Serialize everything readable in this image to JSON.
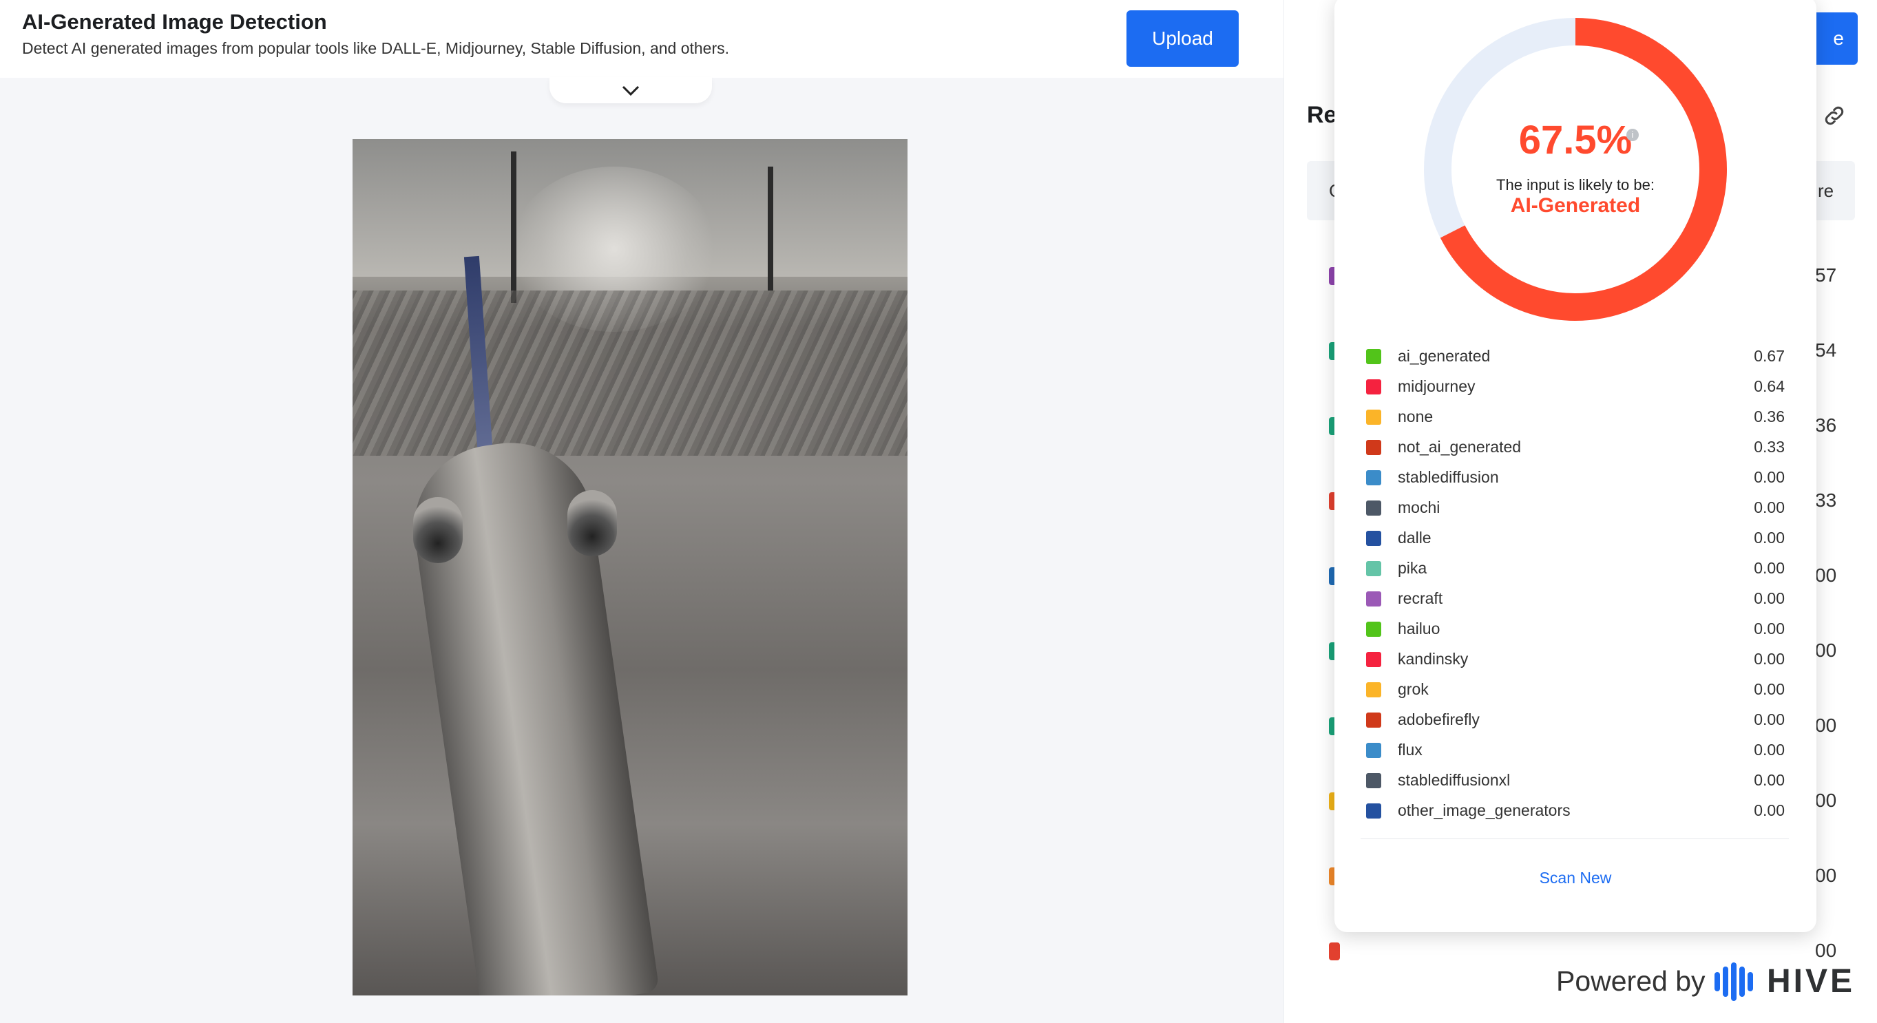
{
  "header": {
    "title": "AI-Generated Image Detection",
    "subtitle": "Detect AI generated images from popular tools like DALL-E, Midjourney, Stable Diffusion, and others.",
    "upload_label": "Upload"
  },
  "preview": {
    "icon": "chevron-down-icon"
  },
  "background_panel": {
    "top_button_label_fragment": "e",
    "results_title_fragment": "Re",
    "col_left_fragment": "C",
    "col_right_fragment": "re",
    "row_values": [
      "57",
      "54",
      "36",
      "33",
      "00",
      "00",
      "00",
      "00",
      "00",
      "00"
    ],
    "row_colors": [
      "#8e44ad",
      "#1aa37a",
      "#1aa37a",
      "#e2402f",
      "#1f6bb5",
      "#1aa37a",
      "#1aa37a",
      "#f0b318",
      "#f0882a",
      "#e2402f"
    ]
  },
  "result": {
    "percent_text": "67.5%",
    "percent_value": 67.5,
    "likely_text": "The input is likely to be:",
    "verdict": "AI-Generated",
    "accent_color": "#ff4a2e",
    "track_color": "#e7eef9",
    "info_icon": "info-icon"
  },
  "scores": [
    {
      "label": "ai_generated",
      "value": "0.67",
      "color": "#52c41a"
    },
    {
      "label": "midjourney",
      "value": "0.64",
      "color": "#f5223f"
    },
    {
      "label": "none",
      "value": "0.36",
      "color": "#fbb428"
    },
    {
      "label": "not_ai_generated",
      "value": "0.33",
      "color": "#d0391a"
    },
    {
      "label": "stablediffusion",
      "value": "0.00",
      "color": "#3b8cc9"
    },
    {
      "label": "mochi",
      "value": "0.00",
      "color": "#4d5866"
    },
    {
      "label": "dalle",
      "value": "0.00",
      "color": "#2451a0"
    },
    {
      "label": "pika",
      "value": "0.00",
      "color": "#64c4a7"
    },
    {
      "label": "recraft",
      "value": "0.00",
      "color": "#9b59b6"
    },
    {
      "label": "hailuo",
      "value": "0.00",
      "color": "#52c41a"
    },
    {
      "label": "kandinsky",
      "value": "0.00",
      "color": "#f5223f"
    },
    {
      "label": "grok",
      "value": "0.00",
      "color": "#fbb428"
    },
    {
      "label": "adobefirefly",
      "value": "0.00",
      "color": "#d0391a"
    },
    {
      "label": "flux",
      "value": "0.00",
      "color": "#3b8cc9"
    },
    {
      "label": "stablediffusionxl",
      "value": "0.00",
      "color": "#4d5866"
    },
    {
      "label": "other_image_generators",
      "value": "0.00",
      "color": "#2451a0"
    }
  ],
  "actions": {
    "scan_new_label": "Scan New"
  },
  "footer": {
    "powered_by": "Powered by",
    "brand": "HIVE",
    "logo_icon": "hive-logo-icon",
    "link_icon": "link-icon"
  }
}
